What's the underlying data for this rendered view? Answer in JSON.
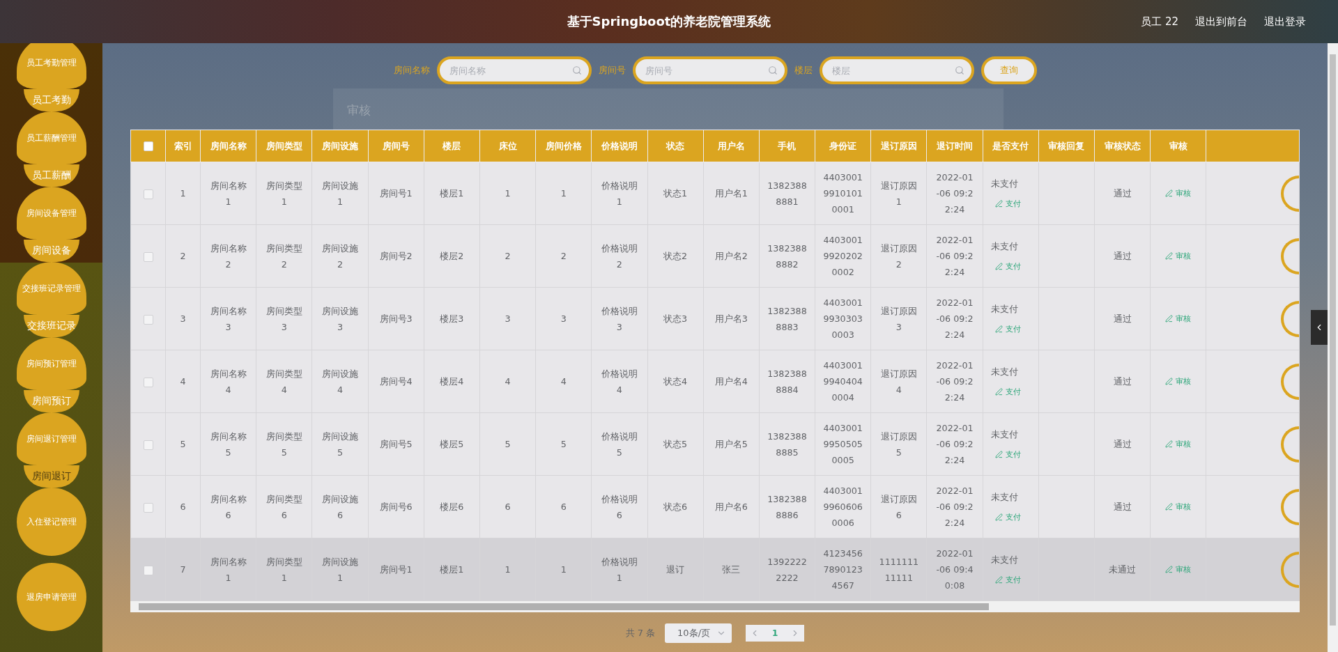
{
  "header": {
    "title": "基于Springboot的养老院管理系统",
    "user": "员工 22",
    "links": [
      "退出到前台",
      "退出登录"
    ]
  },
  "sidebar": {
    "menus": [
      {
        "title": "员工考勤管理",
        "children": [
          {
            "label": "员工考勤",
            "selected": false
          }
        ]
      },
      {
        "title": "员工薪酬管理",
        "children": [
          {
            "label": "员工薪酬",
            "selected": false
          }
        ]
      },
      {
        "title": "房间设备管理",
        "children": [
          {
            "label": "房间设备",
            "selected": false
          }
        ]
      },
      {
        "title": "交接班记录管理",
        "children": [
          {
            "label": "交接班记录",
            "selected": false
          }
        ]
      },
      {
        "title": "房间预订管理",
        "children": [
          {
            "label": "房间预订",
            "selected": false
          }
        ]
      },
      {
        "title": "房间退订管理",
        "children": [
          {
            "label": "房间退订",
            "selected": true
          }
        ]
      },
      {
        "title": "入住登记管理"
      },
      {
        "title": "退房申请管理"
      }
    ]
  },
  "search": {
    "fields": [
      {
        "label": "房间名称",
        "placeholder": "房间名称"
      },
      {
        "label": "房间号",
        "placeholder": "房间号"
      },
      {
        "label": "楼层",
        "placeholder": "楼层"
      }
    ],
    "button": "查询"
  },
  "dialog": {
    "title": "审核"
  },
  "table": {
    "select_all": {
      "checked": false
    },
    "columns": [
      "索引",
      "房间名称",
      "房间类型",
      "房间设施",
      "房间号",
      "楼层",
      "床位",
      "房间价格",
      "价格说明",
      "状态",
      "用户名",
      "手机",
      "身份证",
      "退订原因",
      "退订时间",
      "是否支付",
      "审核回复",
      "审核状态",
      "审核"
    ],
    "rows": [
      {
        "checked": false,
        "highlighted": false,
        "cells": [
          "1",
          "房间名称1",
          "房间类型1",
          "房间设施1",
          "房间号1",
          "楼层1",
          "1",
          "1",
          "价格说明1",
          "状态1",
          "用户名1",
          "13823888881",
          "440300199101010001",
          "退订原因1",
          "2022-01-06 09:22:24"
        ],
        "paid": "未支付",
        "pay_link": "支付",
        "review_status": "通过",
        "review_link": "审核"
      },
      {
        "checked": false,
        "highlighted": false,
        "cells": [
          "2",
          "房间名称2",
          "房间类型2",
          "房间设施2",
          "房间号2",
          "楼层2",
          "2",
          "2",
          "价格说明2",
          "状态2",
          "用户名2",
          "13823888882",
          "440300199202020002",
          "退订原因2",
          "2022-01-06 09:22:24"
        ],
        "paid": "未支付",
        "pay_link": "支付",
        "review_status": "通过",
        "review_link": "审核"
      },
      {
        "checked": false,
        "highlighted": false,
        "cells": [
          "3",
          "房间名称3",
          "房间类型3",
          "房间设施3",
          "房间号3",
          "楼层3",
          "3",
          "3",
          "价格说明3",
          "状态3",
          "用户名3",
          "13823888883",
          "440300199303030003",
          "退订原因3",
          "2022-01-06 09:22:24"
        ],
        "paid": "未支付",
        "pay_link": "支付",
        "review_status": "通过",
        "review_link": "审核"
      },
      {
        "checked": false,
        "highlighted": false,
        "cells": [
          "4",
          "房间名称4",
          "房间类型4",
          "房间设施4",
          "房间号4",
          "楼层4",
          "4",
          "4",
          "价格说明4",
          "状态4",
          "用户名4",
          "13823888884",
          "440300199404040004",
          "退订原因4",
          "2022-01-06 09:22:24"
        ],
        "paid": "未支付",
        "pay_link": "支付",
        "review_status": "通过",
        "review_link": "审核"
      },
      {
        "checked": false,
        "highlighted": false,
        "cells": [
          "5",
          "房间名称5",
          "房间类型5",
          "房间设施5",
          "房间号5",
          "楼层5",
          "5",
          "5",
          "价格说明5",
          "状态5",
          "用户名5",
          "13823888885",
          "440300199505050005",
          "退订原因5",
          "2022-01-06 09:22:24"
        ],
        "paid": "未支付",
        "pay_link": "支付",
        "review_status": "通过",
        "review_link": "审核"
      },
      {
        "checked": false,
        "highlighted": false,
        "cells": [
          "6",
          "房间名称6",
          "房间类型6",
          "房间设施6",
          "房间号6",
          "楼层6",
          "6",
          "6",
          "价格说明6",
          "状态6",
          "用户名6",
          "13823888886",
          "440300199606060006",
          "退订原因6",
          "2022-01-06 09:22:24"
        ],
        "paid": "未支付",
        "pay_link": "支付",
        "review_status": "通过",
        "review_link": "审核"
      },
      {
        "checked": false,
        "highlighted": true,
        "cells": [
          "7",
          "房间名称1",
          "房间类型1",
          "房间设施1",
          "房间号1",
          "楼层1",
          "1",
          "1",
          "价格说明1",
          "退订",
          "张三",
          "13922222222",
          "412345678901234567",
          "111111111111",
          "2022-01-06 09:40:08"
        ],
        "paid": "未支付",
        "pay_link": "支付",
        "review_status": "未通过",
        "review_link": "审核"
      }
    ]
  },
  "pagination": {
    "total": "共 7 条",
    "page_size": "10条/页",
    "pages": [
      {
        "label": "1",
        "selected": true
      }
    ]
  }
}
